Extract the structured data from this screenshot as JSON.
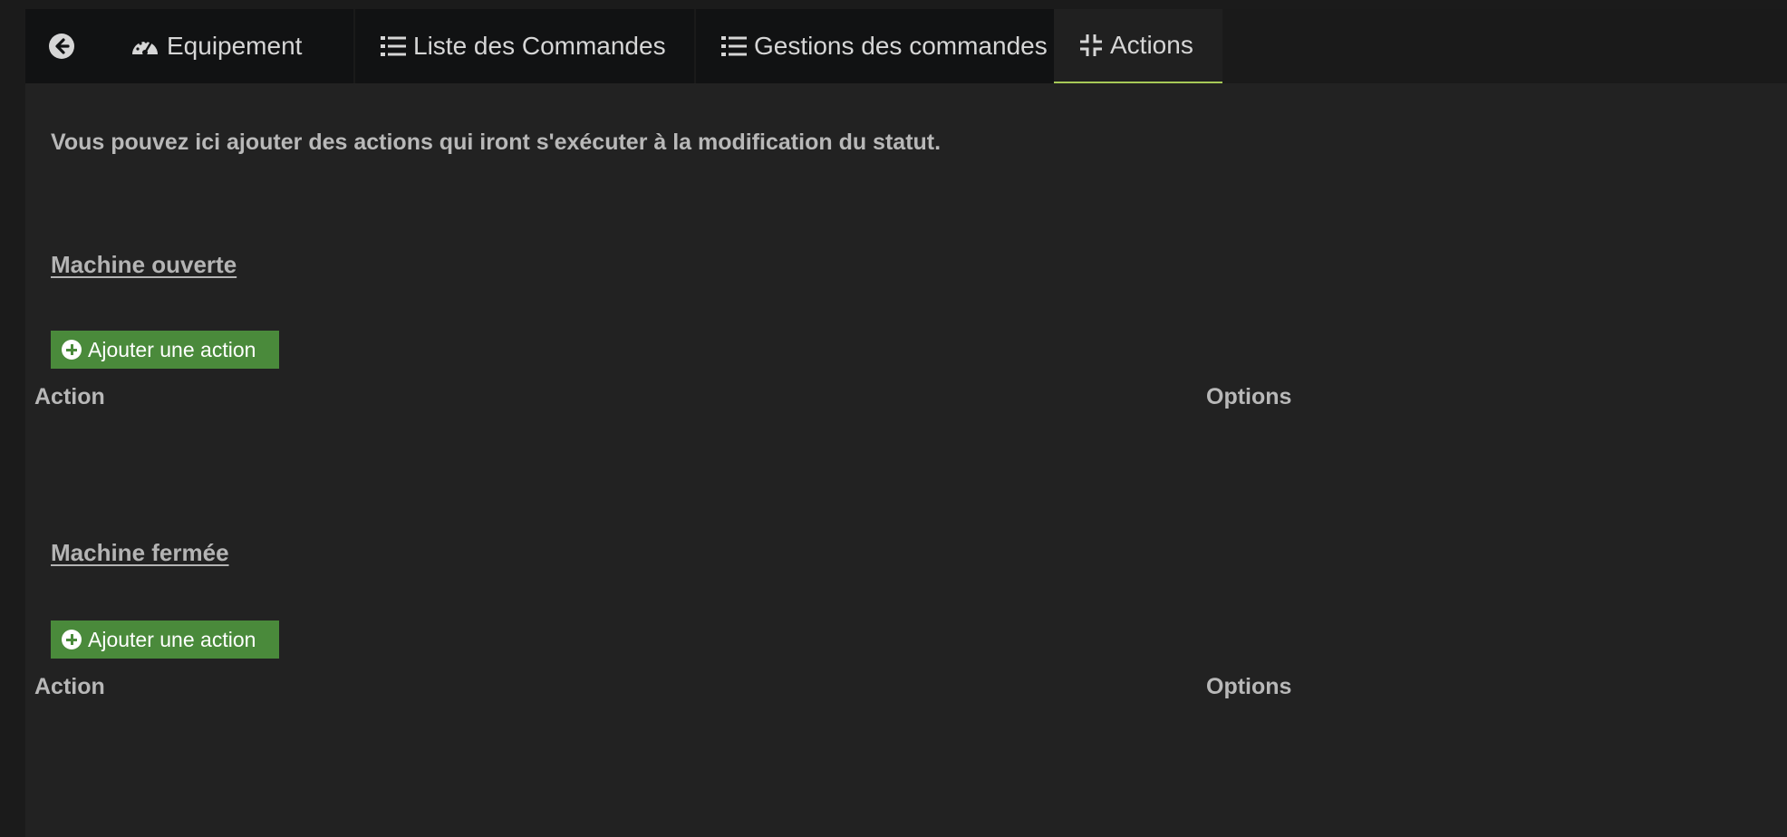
{
  "tabs": {
    "back_icon": "circle-arrow-left-icon",
    "items": [
      {
        "label": "Equipement",
        "icon": "dashboard-gauge-icon"
      },
      {
        "label": "Liste des Commandes",
        "icon": "list-icon"
      },
      {
        "label": "Gestions des commandes",
        "icon": "list-icon"
      },
      {
        "label": "Actions",
        "icon": "compress-icon",
        "active": true
      }
    ],
    "active_accent": "#a7c957"
  },
  "intro_text": "Vous pouvez ici ajouter des actions qui iront s'exécuter à la modification du statut.",
  "sections": [
    {
      "title": "Machine ouverte",
      "add_button": "Ajouter une action",
      "columns": [
        "Action",
        "Options"
      ]
    },
    {
      "title": "Machine fermée",
      "add_button": "Ajouter une action",
      "columns": [
        "Action",
        "Options"
      ]
    }
  ],
  "colors": {
    "background": "#222222",
    "tabbar": "#111213",
    "button_green": "#4a8a3b"
  }
}
